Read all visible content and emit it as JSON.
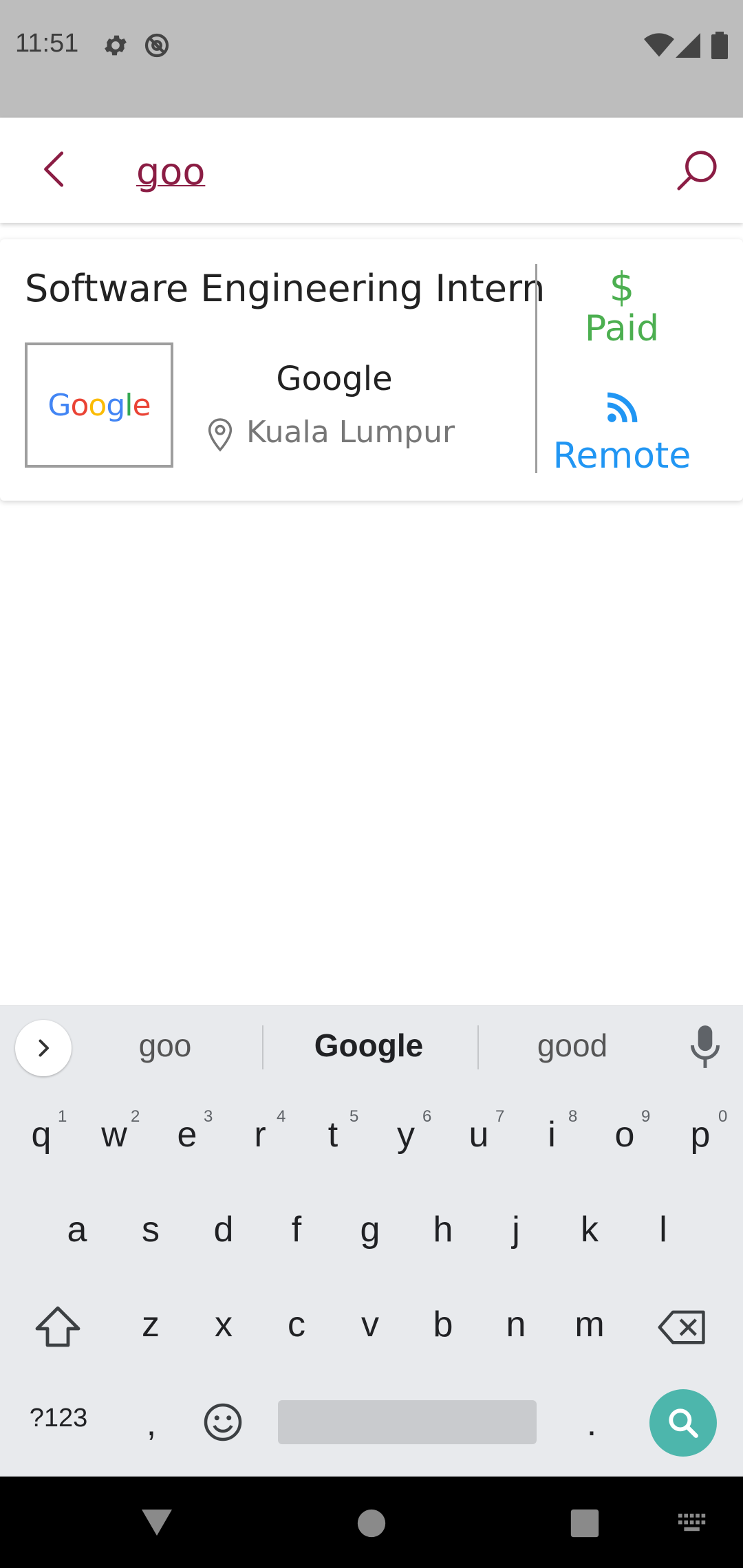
{
  "status_bar": {
    "time": "11:51"
  },
  "search": {
    "value": "goo"
  },
  "result": {
    "title": "Software Engineering Intern",
    "company": "Google",
    "location": "Kuala Lumpur",
    "logo_text": "Google",
    "paid_symbol": "$",
    "paid_label": "Paid",
    "remote_label": "Remote"
  },
  "keyboard": {
    "suggestions": [
      "goo",
      "Google",
      "good"
    ],
    "row1": [
      "q",
      "w",
      "e",
      "r",
      "t",
      "y",
      "u",
      "i",
      "o",
      "p"
    ],
    "row1_hints": [
      "1",
      "2",
      "3",
      "4",
      "5",
      "6",
      "7",
      "8",
      "9",
      "0"
    ],
    "row2": [
      "a",
      "s",
      "d",
      "f",
      "g",
      "h",
      "j",
      "k",
      "l"
    ],
    "row3": [
      "z",
      "x",
      "c",
      "v",
      "b",
      "n",
      "m"
    ],
    "symbols_label": "?123",
    "comma": ",",
    "period": "."
  },
  "colors": {
    "accent": "#8b1d44",
    "paid": "#4caf50",
    "remote": "#2196f3",
    "key_action": "#4db6ac"
  }
}
